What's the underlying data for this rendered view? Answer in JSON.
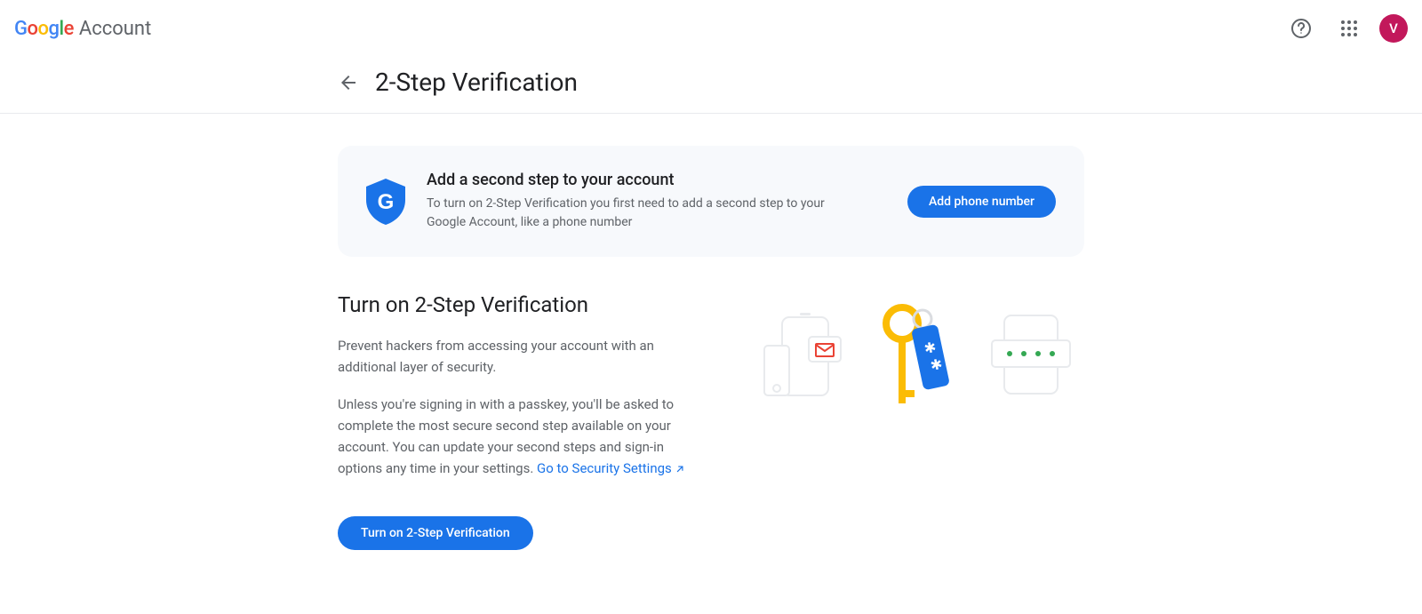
{
  "header": {
    "logo_text": "Google",
    "logo_suffix": "Account",
    "avatar_initial": "V"
  },
  "page": {
    "title": "2-Step Verification"
  },
  "banner": {
    "title": "Add a second step to your account",
    "desc": "To turn on 2-Step Verification you first need to add a second step to your Google Account, like a phone number",
    "button": "Add phone number"
  },
  "section": {
    "title": "Turn on 2-Step Verification",
    "para1": "Prevent hackers from accessing your account with an additional layer of security.",
    "para2_pre": "Unless you're signing in with a passkey, you'll be asked to complete the most secure second step available on your account. You can update your second steps and sign-in options any time in your settings. ",
    "link_text": "Go to Security Settings",
    "button": "Turn on 2-Step Verification"
  }
}
